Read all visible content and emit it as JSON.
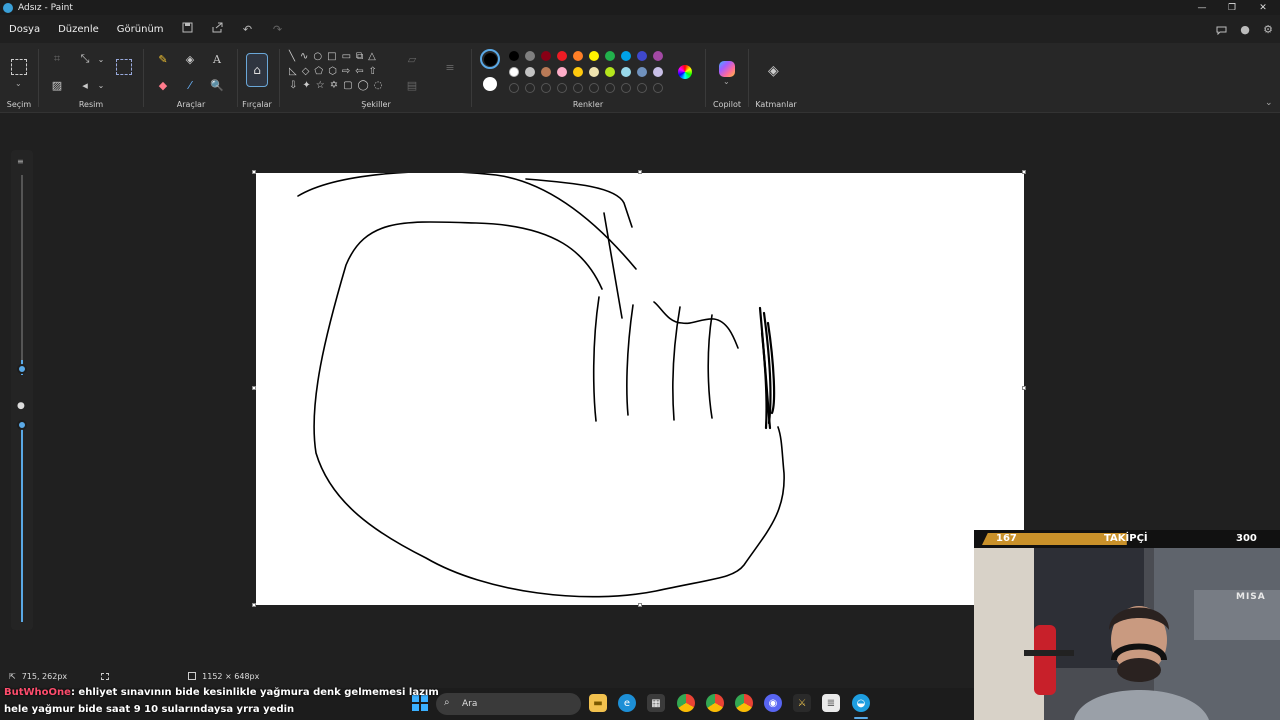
{
  "window": {
    "title": "Adsız - Paint"
  },
  "menu": {
    "items": [
      "Dosya",
      "Düzenle",
      "Görünüm"
    ]
  },
  "ribbon": {
    "groups": {
      "selection": "Seçim",
      "image": "Resim",
      "tools": "Araçlar",
      "brushes": "Fırçalar",
      "shapes": "Şekiller",
      "colors": "Renkler",
      "copilot": "Copilot",
      "layers": "Katmanlar"
    },
    "tool_icons": {
      "text": "A",
      "zoom": "🔍"
    }
  },
  "colors": {
    "row1": [
      "#000000",
      "#7f7f7f",
      "#880015",
      "#ed1c24",
      "#ff7f27",
      "#fff200",
      "#22b14c",
      "#00a2e8",
      "#3f48cc",
      "#a349a4"
    ],
    "row2": [
      "#ffffff",
      "#c3c3c3",
      "#b97a57",
      "#ffaec9",
      "#ffc90e",
      "#efe4b0",
      "#b5e61d",
      "#99d9ea",
      "#7092be",
      "#c8bfe7"
    ],
    "primary": "#000000",
    "secondary": "#ffffff"
  },
  "status": {
    "cursor_pos": "715, 262px",
    "canvas_size": "1152 × 648px"
  },
  "chat": {
    "username": "ButWhoOne",
    "message": ": ehliyet sınavının bide kesinlikle yağmura denk gelmemesi lazım hele yağmur bide saat 9 10 sularındaysa yrra yedin"
  },
  "stream": {
    "followers_current": "167",
    "followers_label": "TAKİPÇİ",
    "followers_goal": "300",
    "followers_progress": 0.557,
    "watermark": "MISA"
  },
  "taskbar": {
    "search_placeholder": "Ara"
  }
}
